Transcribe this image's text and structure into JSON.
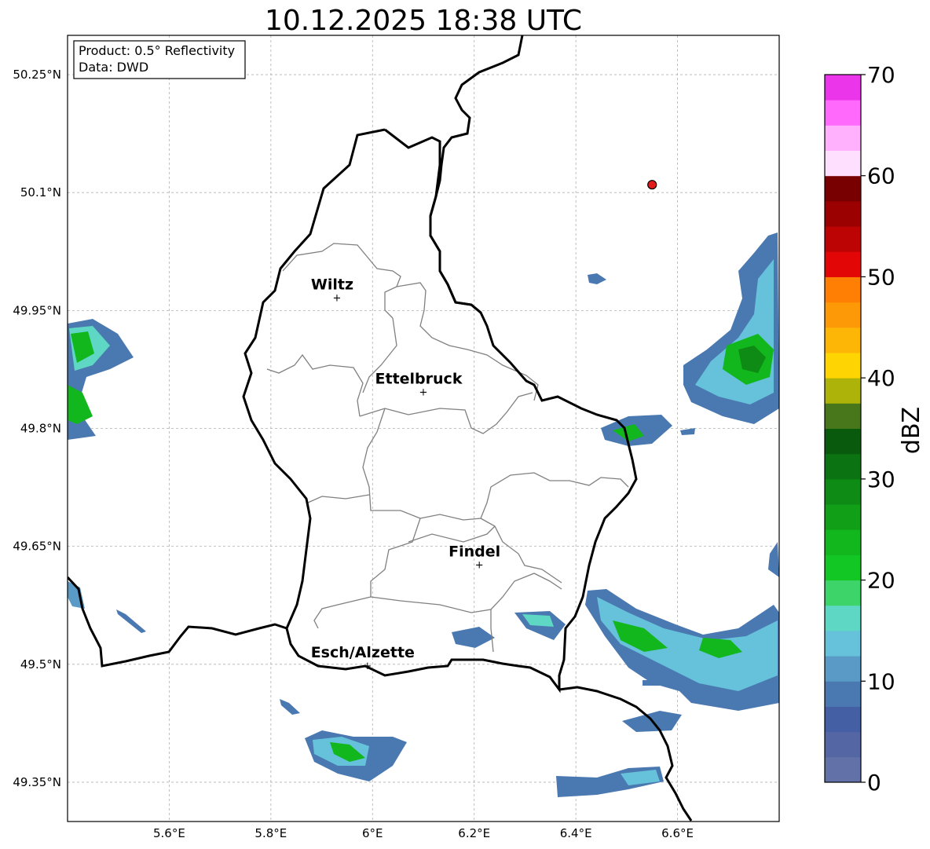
{
  "title": "10.12.2025 18:38 UTC",
  "info_box": {
    "product_line": "Product: 0.5° Reflectivity",
    "data_line": "Data: DWD"
  },
  "map": {
    "lon_range": [
      5.4,
      6.8
    ],
    "lat_range": [
      49.3,
      50.3
    ],
    "lon_ticks": [
      5.6,
      5.8,
      6.0,
      6.2,
      6.4,
      6.6
    ],
    "lon_tick_labels": [
      "5.6°E",
      "5.8°E",
      "6°E",
      "6.2°E",
      "6.4°E",
      "6.6°E"
    ],
    "lat_ticks": [
      50.25,
      50.1,
      49.95,
      49.8,
      49.65,
      49.5,
      49.35
    ],
    "lat_tick_labels": [
      "50.25°N",
      "50.1°N",
      "49.95°N",
      "49.8°N",
      "49.65°N",
      "49.5°N",
      "49.35°N"
    ],
    "grid": true,
    "cities": [
      {
        "name": "Wiltz",
        "lon": 5.93,
        "lat": 49.967
      },
      {
        "name": "Ettelbruck",
        "lon": 6.1,
        "lat": 49.847
      },
      {
        "name": "Findel",
        "lon": 6.21,
        "lat": 49.627
      },
      {
        "name": "Esch/Alzette",
        "lon": 5.99,
        "lat": 49.499
      }
    ],
    "radar_site": {
      "lon": 6.55,
      "lat": 50.11,
      "color": "#e31a1c"
    }
  },
  "colorbar": {
    "label": "dBZ",
    "min": 0,
    "max": 70,
    "ticks": [
      0,
      10,
      20,
      30,
      40,
      50,
      60,
      70
    ],
    "colors": [
      "#6272a8",
      "#5466a4",
      "#445fa4",
      "#4a78b0",
      "#5a9ac6",
      "#66c1da",
      "#5ed8c4",
      "#3dd46a",
      "#12c624",
      "#12b61d",
      "#119f17",
      "#0e8b14",
      "#0b7311",
      "#0a5a0e",
      "#48761a",
      "#adb309",
      "#fed503",
      "#fdb606",
      "#fd9906",
      "#fe7f04",
      "#e30606",
      "#bd0404",
      "#9b0101",
      "#780001",
      "#ffdffe",
      "#ffb1fe",
      "#ff6afd",
      "#eb35ea"
    ]
  },
  "colors": {
    "country_border": "#000000",
    "canton_border": "#808080",
    "grid": "#b0b0b0"
  }
}
